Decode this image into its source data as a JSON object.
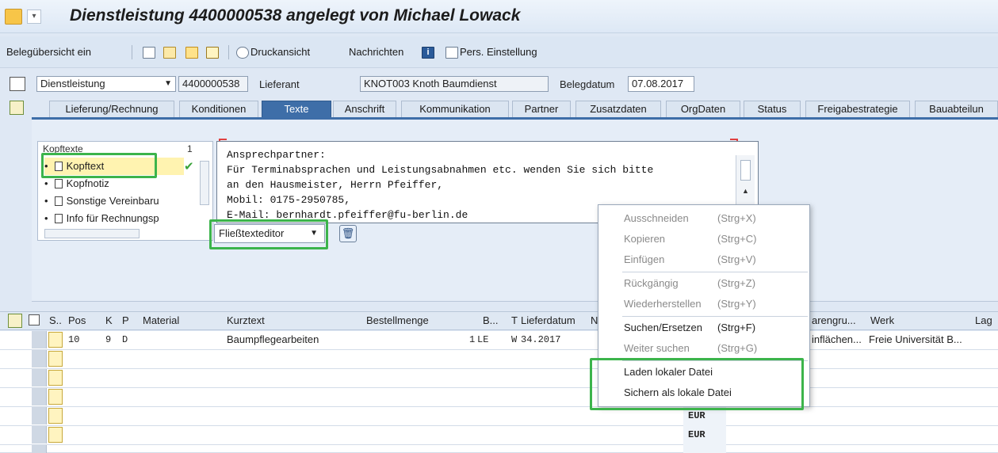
{
  "window": {
    "title": "Dienstleistung 4400000538 angelegt von Michael Lowack"
  },
  "toolbar": {
    "beleguebersicht": "Belegübersicht ein",
    "druckansicht": "Druckansicht",
    "nachrichten": "Nachrichten",
    "pers_einstellung": "Pers. Einstellung"
  },
  "header": {
    "doc_type": "Dienstleistung",
    "doc_number": "4400000538",
    "lieferant_label": "Lieferant",
    "lieferant_value": "KNOT003 Knoth Baumdienst",
    "belegdatum_label": "Belegdatum",
    "belegdatum_value": "07.08.2017"
  },
  "tabs": [
    {
      "label": "Lieferung/Rechnung"
    },
    {
      "label": "Konditionen"
    },
    {
      "label": "Texte",
      "active": true
    },
    {
      "label": "Anschrift"
    },
    {
      "label": "Kommunikation"
    },
    {
      "label": "Partner"
    },
    {
      "label": "Zusatzdaten"
    },
    {
      "label": "OrgDaten"
    },
    {
      "label": "Status"
    },
    {
      "label": "Freigabestrategie"
    },
    {
      "label": "Bauabteilun"
    }
  ],
  "texts": {
    "tree_header": "Kopftexte",
    "tree_header_col": "1",
    "items": [
      {
        "label": "Kopftext"
      },
      {
        "label": "Kopfnotiz"
      },
      {
        "label": "Sonstige Vereinbaru"
      },
      {
        "label": "Info für Rechnungsp"
      }
    ],
    "editor_lines": [
      "Ansprechpartner:",
      "Für Terminabsprachen und Leistungsabnahmen etc. wenden Sie sich bitte",
      "an den Hausmeister, Herrn Pfeiffer,",
      "Mobil: 0175-2950785,",
      "E-Mail: bernhardt.pfeiffer@fu-berlin.de"
    ],
    "editor_mode": "Fließtexteditor"
  },
  "items_table": {
    "headers": {
      "s": "S..",
      "pos": "Pos",
      "k": "K",
      "p": "P",
      "material": "Material",
      "kurztext": "Kurztext",
      "bestellmenge": "Bestellmenge",
      "b": "B...",
      "t": "T",
      "lieferdatum": "Lieferdatum",
      "n": "N",
      "warengruppe": "arengru...",
      "werk": "Werk",
      "lag": "Lag"
    },
    "row1": {
      "pos": "10",
      "k": "9",
      "p": "D",
      "kurztext": "Baumpflegearbeiten",
      "menge": "1",
      "einheit": "LE",
      "t": "W",
      "lieferdatum": "34.2017",
      "warengruppe": "inflächen...",
      "werk": "Freie Universität B..."
    },
    "currency_rows": [
      "EUR",
      "EUR",
      "EUR"
    ]
  },
  "context_menu": {
    "items": [
      {
        "label": "Ausschneiden",
        "shortcut": "(Strg+X)"
      },
      {
        "label": "Kopieren",
        "shortcut": "(Strg+C)"
      },
      {
        "label": "Einfügen",
        "shortcut": "(Strg+V)"
      },
      {
        "label": "Rückgängig",
        "shortcut": "(Strg+Z)"
      },
      {
        "label": "Wiederherstellen",
        "shortcut": "(Strg+Y)"
      },
      {
        "label": "Suchen/Ersetzen",
        "shortcut": "(Strg+F)"
      },
      {
        "label": "Weiter suchen",
        "shortcut": "(Strg+G)"
      },
      {
        "label": "Laden lokaler Datei"
      },
      {
        "label": "Sichern als lokale Datei"
      }
    ]
  },
  "colors": {
    "highlight": "#3cb44b",
    "active_tab": "#3e6ea8"
  }
}
